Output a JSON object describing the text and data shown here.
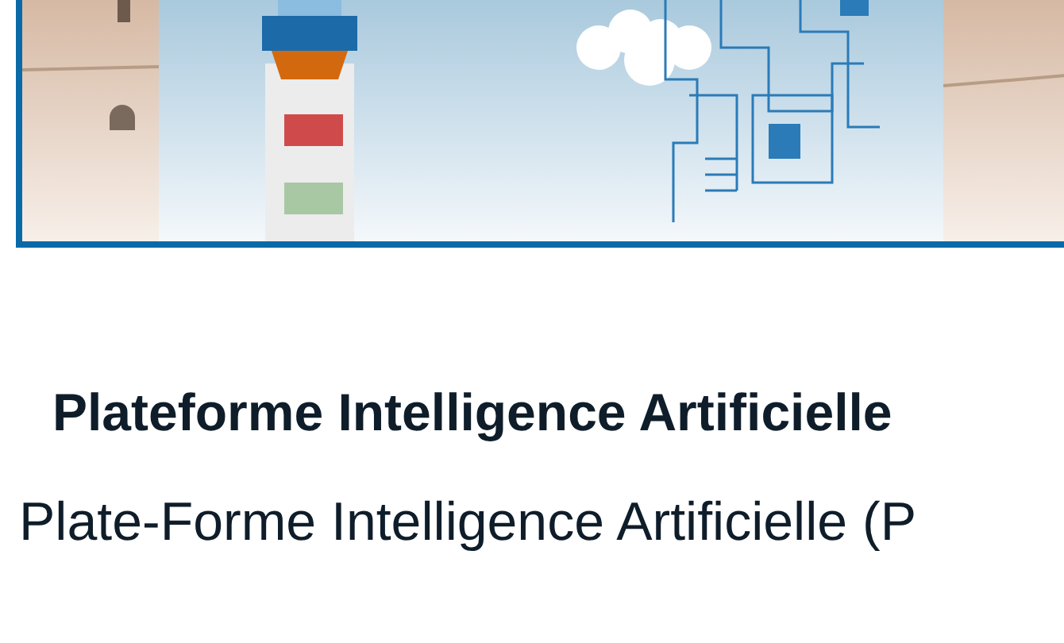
{
  "heading": "Plateforme Intelligence Artificielle",
  "paragraph": "Plate-Forme Intelligence Artificielle (P"
}
